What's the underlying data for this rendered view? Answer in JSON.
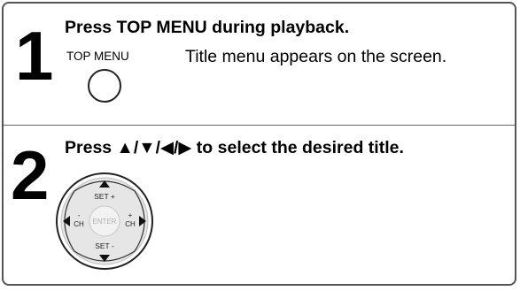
{
  "step1": {
    "number": "1",
    "instruction": "Press TOP MENU during playback.",
    "button_label": "TOP MENU",
    "description": "Title menu appears on the screen."
  },
  "step2": {
    "number": "2",
    "instruction": "Press ▲/▼/◀/▶ to select the desired title.",
    "remote": {
      "set_plus": "SET +",
      "set_minus": "SET -",
      "ch_minus_sign": "-",
      "ch_plus_sign": "+",
      "ch_left": "CH",
      "ch_right": "CH",
      "enter": "ENTER"
    }
  },
  "colors": {
    "border": "#555555",
    "pad_fill": "#e6e6e6",
    "pad_ring": "#bdbdbd"
  }
}
